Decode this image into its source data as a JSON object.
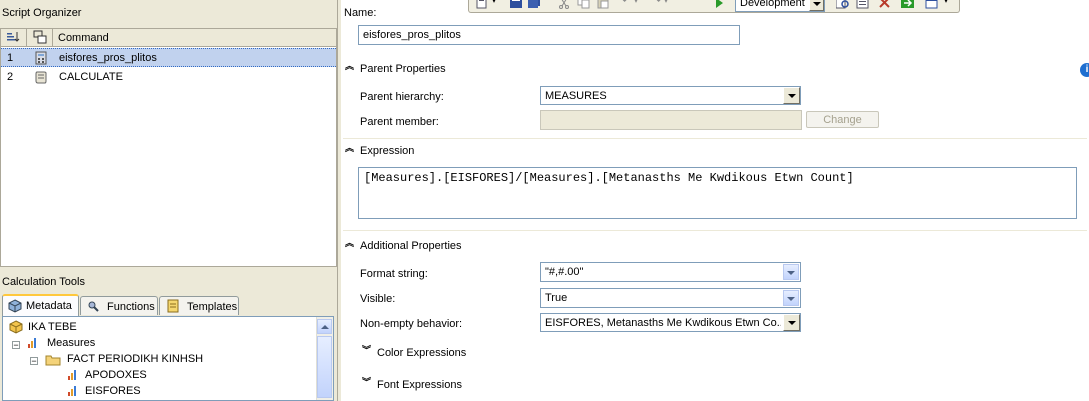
{
  "script_organizer": {
    "title": "Script Organizer",
    "column_header": "Command",
    "rows": [
      {
        "num": "1",
        "command": "eisfores_pros_plitos",
        "selected": true
      },
      {
        "num": "2",
        "command": "CALCULATE",
        "selected": false
      }
    ]
  },
  "calc_tools": {
    "title": "Calculation Tools",
    "tabs": [
      "Metadata",
      "Functions",
      "Templates"
    ],
    "tree": [
      "IKA TEBE",
      "Measures",
      "FACT PERIODIKH KINHSH",
      "APODOXES",
      "EISFORES"
    ]
  },
  "toolbar": {
    "environment": "Development"
  },
  "form": {
    "name_label": "Name:",
    "name_value": "eisfores_pros_plitos",
    "parent_section": "Parent Properties",
    "parent_hierarchy_label": "Parent hierarchy:",
    "parent_hierarchy_value": "MEASURES",
    "parent_member_label": "Parent member:",
    "change_button": "Change",
    "expression_section": "Expression",
    "expression_value": "[Measures].[EISFORES]/[Measures].[Metanasths Me Kwdikous Etwn Count]",
    "additional_section": "Additional Properties",
    "format_label": "Format string:",
    "format_value": "\"#,#.00\"",
    "visible_label": "Visible:",
    "visible_value": "True",
    "nonempty_label": "Non-empty behavior:",
    "nonempty_value": "EISFORES, Metanasths Me Kwdikous Etwn Co...",
    "color_section": "Color Expressions",
    "font_section": "Font Expressions"
  },
  "colors": {
    "selection": "#c1d2ee",
    "panel": "#ece9d8",
    "accent_tab": "#ffc83c"
  }
}
